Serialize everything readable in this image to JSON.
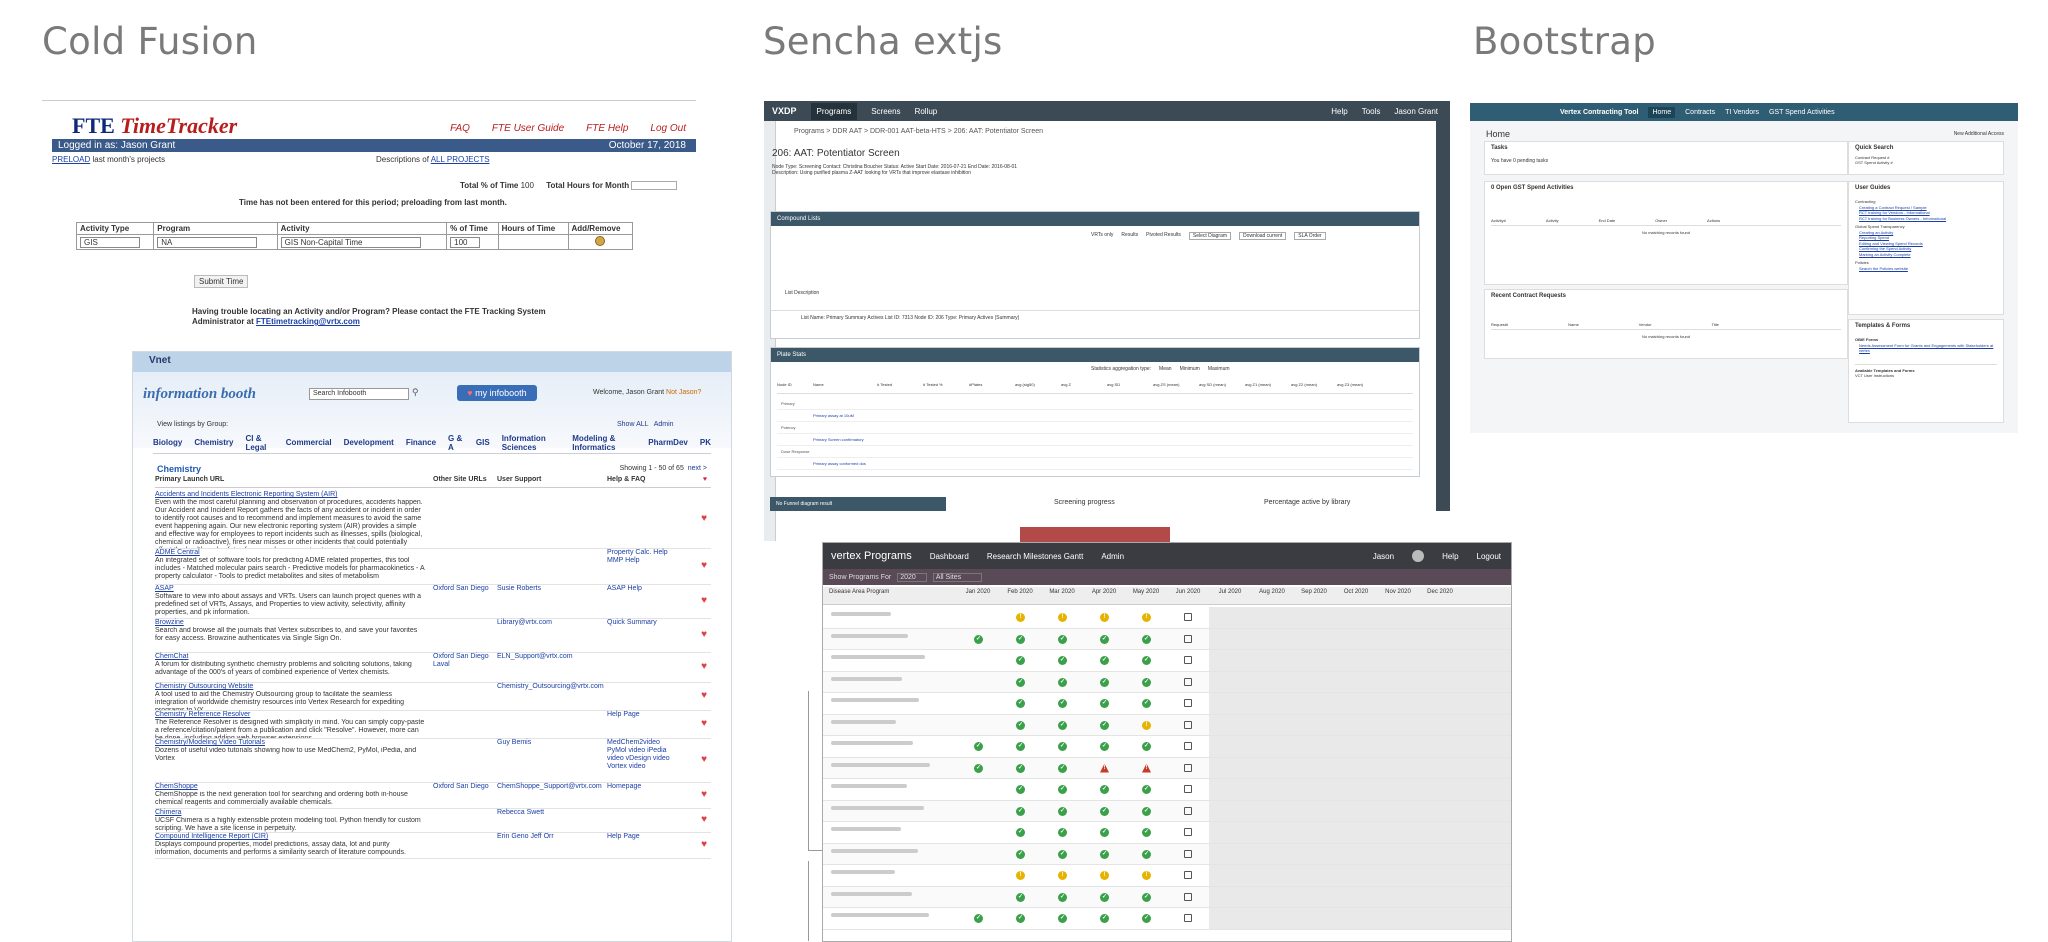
{
  "columns": {
    "col1": "Cold Fusion",
    "col2": "Sencha extjs",
    "col3": "Bootstrap"
  },
  "fte": {
    "brand_a": "FTE",
    "brand_b": "TimeTracker",
    "nav": [
      "FAQ",
      "FTE User Guide",
      "FTE Help",
      "Log Out"
    ],
    "logged_in": "Logged in as: Jason Grant",
    "date": "October 17, 2018",
    "preload_link": "PRELOAD",
    "preload_text": "last month's projects",
    "desc_text": "Descriptions of",
    "desc_link": "ALL PROJECTS",
    "total_pct_label": "Total % of Time",
    "total_pct_value": "100",
    "total_hours_label": "Total Hours for Month",
    "notice": "Time has not been entered for this period; preloading from last month.",
    "headers": [
      "Activity Type",
      "Program",
      "Activity",
      "% of Time",
      "Hours of Time",
      "Add/Remove"
    ],
    "row": {
      "type": "GIS",
      "program": "NA",
      "activity": "GIS Non-Capital Time",
      "pct": "100"
    },
    "submit": "Submit Time",
    "trouble": "Having trouble locating an Activity and/or Program? Please contact the FTE Tracking System",
    "admin_text": "Administrator at",
    "admin_email": "FTEtimetracking@vrtx.com"
  },
  "vnet": {
    "title": "Vnet",
    "logo": "information booth",
    "search_placeholder": "Search Infobooth",
    "my_infobooth": "my infobooth",
    "welcome": "Welcome, Jason Grant",
    "not_you": "Not Jason?",
    "view_listings": "View listings by Group:",
    "show_all": "Show ALL",
    "admin": "Admin",
    "categories": [
      "Biology",
      "Chemistry",
      "CI & Legal",
      "Commercial",
      "Development",
      "Finance",
      "G & A",
      "GIS",
      "Information Sciences",
      "Modeling & Informatics",
      "PharmDev",
      "PK"
    ],
    "section": "Chemistry",
    "showing": "Showing 1 - 50 of 65",
    "next": "next >",
    "table_headers": [
      "Primary Launch URL",
      "Other Site URLs",
      "User Support",
      "Help & FAQ"
    ],
    "rows": [
      {
        "name": "Accidents and Incidents Electronic Reporting System (AIR)",
        "desc": "Even with the most careful planning and observation of procedures, accidents happen. Our Accident and Incident Report gathers the facts of any accident or incident in order to identify root causes and to recommend and implement measures to avoid the same event happening again. Our new electronic reporting system (AIR) provides a simple and effective way for employees to report incidents such as illnesses, spills (biological, chemical or radioactive), fires near misses or other incidents that could potentially affect the health and safety of our employees, contractors or visitors.",
        "sites": "",
        "support": "",
        "help": ""
      },
      {
        "name": "ADME Central",
        "desc": "An integrated set of software tools for predicting ADME related properties, this tool includes - Matched molecular pairs search - Predictive models for pharmacokinetics - A property calculator - Tools to predict metabolites and sites of metabolism",
        "sites": "",
        "support": "",
        "help": "Property Calc. Help  MMP Help"
      },
      {
        "name": "ASAP",
        "desc": "Software to view info about assays and VRTs. Users can launch project queries with a predefined set of VRTs, Assays, and Properties to view activity, selectivity, affinity properties, and pk information.",
        "sites": "Oxford  San Diego",
        "support": "Susie Roberts",
        "help": "ASAP Help"
      },
      {
        "name": "Browzine",
        "desc": "Search and browse all the journals that Vertex subscribes to, and save your favorites for easy access.  Browzine authenticates via Single Sign On.",
        "sites": "",
        "support": "Library@vrtx.com",
        "help": "Quick Summary"
      },
      {
        "name": "ChemChat",
        "desc": "A forum for distributing synthetic chemistry problems and soliciting solutions, taking advantage of the 000's of years of combined experience of Vertex chemists.",
        "sites": "Oxford  San Diego  Laval",
        "support": "ELN_Support@vrtx.com",
        "help": ""
      },
      {
        "name": "Chemistry Outsourcing Website",
        "desc": "A tool used to aid the Chemistry Outsourcing group to facilitate the seamless integration of worldwide chemistry resources into Vertex Research for expediting programs to VX.",
        "sites": "",
        "support": "Chemistry_Outsourcing@vrtx.com",
        "help": ""
      },
      {
        "name": "Chemistry Reference Resolver",
        "desc": "The Reference Resolver is designed with simplicity in mind. You can simply copy-paste a reference/citation/patent from a publication and click \"Resolve\". However, more can be done, including adding web browser extensions.",
        "sites": "",
        "support": "",
        "help": "Help Page"
      },
      {
        "name": "Chemistry/Modeling Video Tutorials",
        "desc": "Dozens of useful video tutorials showing how to use MedChem2, PyMol, iPedia, and Vortex",
        "sites": "",
        "support": "Guy Bemis",
        "help": "MedChem2video  PyMol video  iPedia video  vDesign video  Vortex video"
      },
      {
        "name": "ChemShoppe",
        "desc": "ChemShoppe is the next generation tool for searching and ordering both in-house chemical reagents and commercially available chemicals.",
        "sites": "Oxford  San Diego",
        "support": "ChemShoppe_Support@vrtx.com",
        "help": "Homepage"
      },
      {
        "name": "Chimera",
        "desc": "UCSF Chimera is a highly extensible protein modeling tool. Python friendly for custom scripting. We have a site license in perpetuity.",
        "sites": "",
        "support": "Rebecca Swett",
        "help": ""
      },
      {
        "name": "Compound Intelligence Report (CIR)",
        "desc": "Displays compound properties, model predictions, assay data, lot and purity information, documents and performs a similarity search of literature compounds.",
        "sites": "",
        "support": "Erin Geno  Jeff Orr",
        "help": "Help Page"
      }
    ]
  },
  "sencha": {
    "app": "VXDP",
    "tabs": [
      "Programs",
      "Screens",
      "Rollup"
    ],
    "top_right": [
      "Help",
      "Tools",
      "Jason Grant"
    ],
    "breadcrumb": "Programs  >  DDR AAT  >  DDR-001 AAT-beta-HTS  >  206: AAT: Potentiator Screen",
    "screen_title": "206: AAT: Potentiator Screen",
    "screen_meta": "Node Type: Screening  Contact: Christina Boucher  Status: Active  Start Date: 2016-07-21  End Date: 2016-08-01",
    "screen_desc": "Description: Using purified plasma Z-AAT looking for VRTs that improve elastase inhibition",
    "compound_lists": "Compound Lists",
    "list_options": [
      "VRTs only",
      "Results",
      "Pivoted Results"
    ],
    "list_buttons": [
      "Select Diagram",
      "Download current",
      "SLA Order"
    ],
    "list_desc_header": "List Description",
    "list_row": "List Name: Primary Summary Actives  List ID: 7313  Node ID: 206  Type: Primary Actives (Summary)",
    "plate_stats": "Plate Stats",
    "stats_label": "Statistics aggregation type:",
    "stats_options": [
      "Mean",
      "Minimum",
      "Maximum"
    ],
    "stats_headers": [
      "Node ID",
      "Name",
      "# Tested",
      "# Tested %",
      "#Plates",
      "avg (sig50)",
      "avg Z",
      "avg SD",
      "avg ZS (mean)",
      "avg SD (mean)",
      "avg Z1 (mean)",
      "avg Z2 (mean)",
      "avg Z3 (mean)"
    ],
    "stats_rows": [
      "Primary",
      "Primary assay at 10uM",
      "Potency",
      "Primary Screen confirmatory",
      "Dose Response",
      "Primary assay conformed dos"
    ],
    "screening_progress": "Screening progress",
    "pct_active": "Percentage active by library",
    "no_funnel": "No Funnel diagram result"
  },
  "programs": {
    "app": "vertex Programs",
    "tabs": [
      "Dashboard",
      "Research Milestones Gantt",
      "Admin"
    ],
    "user": "Jason",
    "help": "Help",
    "logout": "Logout",
    "show_label": "Show Programs For",
    "year": "2020",
    "sites": "All Sites",
    "col_header": "Disease Area Program",
    "months": [
      "Jan 2020",
      "Feb 2020",
      "Mar 2020",
      "Apr 2020",
      "May 2020",
      "Jun 2020",
      "Jul 2020",
      "Aug 2020",
      "Sep 2020",
      "Oct 2020",
      "Nov 2020",
      "Dec 2020"
    ],
    "status_rows": [
      [
        "",
        "w",
        "w",
        "w",
        "w",
        "e"
      ],
      [
        "o",
        "o",
        "o",
        "o",
        "o",
        "e"
      ],
      [
        "",
        "o",
        "o",
        "o",
        "o",
        "e"
      ],
      [
        "",
        "o",
        "o",
        "o",
        "o",
        "e"
      ],
      [
        "",
        "o",
        "o",
        "o",
        "o",
        "e"
      ],
      [
        "",
        "o",
        "o",
        "o",
        "w",
        "e"
      ],
      [
        "o",
        "o",
        "o",
        "o",
        "o",
        "e"
      ],
      [
        "o",
        "o",
        "o",
        "a",
        "a",
        "e"
      ],
      [
        "",
        "o",
        "o",
        "o",
        "o",
        "e"
      ],
      [
        "",
        "o",
        "o",
        "o",
        "o",
        "e"
      ],
      [
        "",
        "o",
        "o",
        "o",
        "o",
        "e"
      ],
      [
        "",
        "o",
        "o",
        "o",
        "o",
        "e"
      ],
      [
        "",
        "w",
        "w",
        "w",
        "w",
        "e"
      ],
      [
        "",
        "o",
        "o",
        "o",
        "o",
        "e"
      ],
      [
        "o",
        "o",
        "o",
        "o",
        "o",
        "e"
      ]
    ]
  },
  "bootstrap": {
    "app": "Vertex Contracting Tool",
    "nav": [
      "Home",
      "Contracts",
      "TI Vendors",
      "GST Spend Activities"
    ],
    "right": "New Additional Access",
    "home": "Home",
    "tasks": "Tasks",
    "pending": "You have 0 pending tasks",
    "quick_search": "Quick Search",
    "qs_options": [
      "Contract Request #",
      "GST Spend Activity #"
    ],
    "open_gst": "0 Open GST Spend Activities",
    "gst_headers": [
      "Activity#",
      "Activity",
      "End Date",
      "Owner",
      "Actions"
    ],
    "no_records": "No matching records found",
    "recent": "Recent Contract Requests",
    "recent_headers": [
      "Request#",
      "Name",
      "Vendor",
      "Title"
    ],
    "user_guides": "User Guides",
    "guides_contracting": "Contracting",
    "guides": [
      "Creating a Contract Request / Sample",
      "RCT training for Vendors - Informational",
      "RCT training for Business Owners - Informational"
    ],
    "guides_gst": "Global Spend Transparency",
    "guides2": [
      "Creating an Activity",
      "Reporting Spend",
      "Editing and Viewing Spend Records",
      "Confirming the Spend Activity",
      "Marking an Activity Complete"
    ],
    "policies": "Policies",
    "policy_link": "Search the Policies website",
    "templates": "Templates & Forms",
    "obie": "OBIE Forms",
    "obie_link": "Needs Assessment Form for Grants and Engagements with Stakeholders at vertex",
    "available": "Available Templates and Forms",
    "vct": "VCT User Instructions"
  }
}
